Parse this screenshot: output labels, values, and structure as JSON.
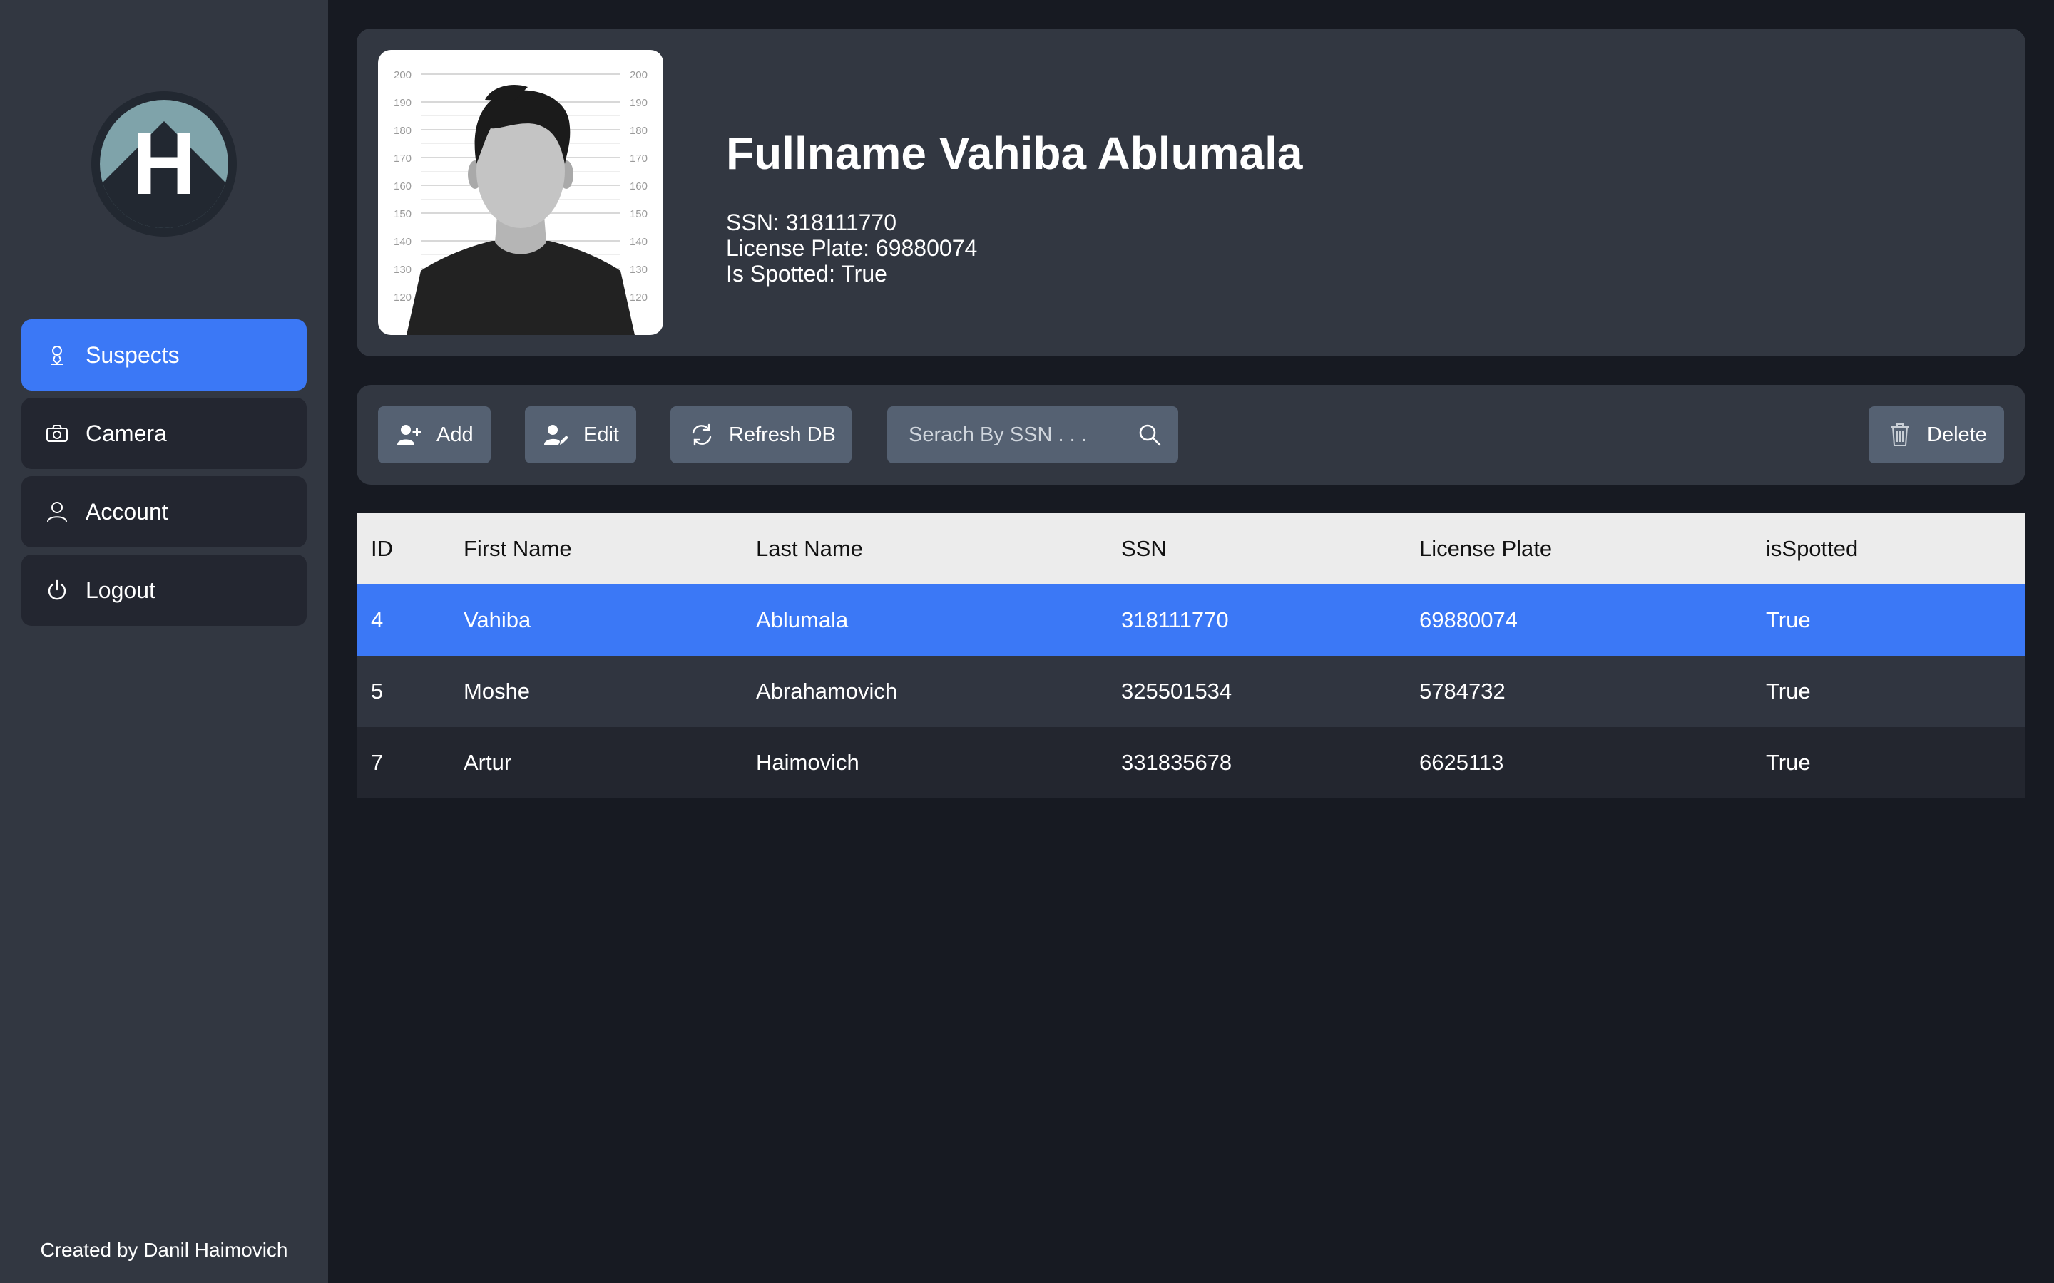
{
  "app": {
    "logo_letter": "H",
    "credit": "Created by Danil Haimovich"
  },
  "sidebar": {
    "items": [
      {
        "label": "Suspects",
        "icon": "suspect-icon",
        "active": true
      },
      {
        "label": "Camera",
        "icon": "camera-icon",
        "active": false
      },
      {
        "label": "Account",
        "icon": "user-icon",
        "active": false
      },
      {
        "label": "Logout",
        "icon": "power-icon",
        "active": false
      }
    ]
  },
  "profile": {
    "name": "Fullname Vahiba Ablumala",
    "ssn": "SSN: 318111770",
    "license_plate": "License Plate: 69880074",
    "is_spotted": "Is Spotted: True",
    "photo_scale": [
      "200",
      "190",
      "180",
      "170",
      "160",
      "150",
      "140",
      "130",
      "120"
    ]
  },
  "toolbar": {
    "add_label": "Add",
    "edit_label": "Edit",
    "refresh_label": "Refresh DB",
    "search_placeholder": "Serach By SSN . . .",
    "delete_label": "Delete"
  },
  "table": {
    "headers": [
      "ID",
      "First Name",
      "Last Name",
      "SSN",
      "License Plate",
      "isSpotted"
    ],
    "rows": [
      [
        "4",
        "Vahiba",
        "Ablumala",
        "318111770",
        "69880074",
        "True"
      ],
      [
        "5",
        "Moshe",
        "Abrahamovich",
        "325501534",
        "5784732",
        "True"
      ],
      [
        "7",
        "Artur",
        "Haimovich",
        "331835678",
        "6625113",
        "True"
      ]
    ],
    "selected_row": 0
  },
  "colors": {
    "accent": "#3b78f6",
    "sidebar_bg": "#323741",
    "page_bg": "#171a22",
    "button_bg": "#556172"
  }
}
